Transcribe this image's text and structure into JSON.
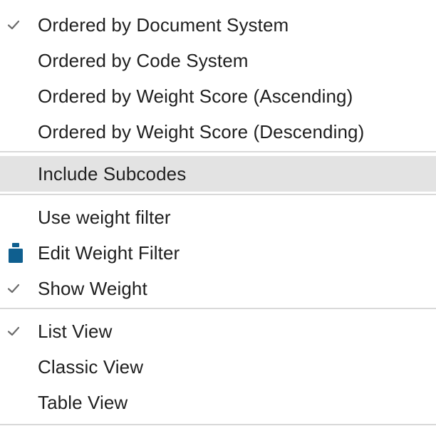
{
  "menu": {
    "sort_group": [
      {
        "label": "Ordered by Document System",
        "checked": true
      },
      {
        "label": "Ordered by Code System",
        "checked": false
      },
      {
        "label": "Ordered by Weight Score (Ascending)",
        "checked": false
      },
      {
        "label": "Ordered by Weight Score (Descending)",
        "checked": false
      }
    ],
    "subcodes_group": [
      {
        "label": "Include Subcodes",
        "checked": false,
        "highlighted": true
      }
    ],
    "weight_group": [
      {
        "label": "Use weight filter",
        "checked": false
      },
      {
        "label": "Edit Weight Filter",
        "icon": "weight-icon"
      },
      {
        "label": "Show Weight",
        "checked": true
      }
    ],
    "view_group": [
      {
        "label": "List View",
        "checked": true
      },
      {
        "label": "Classic View",
        "checked": false
      },
      {
        "label": "Table View",
        "checked": false
      }
    ]
  },
  "colors": {
    "highlight": "#e3e3e3",
    "separator": "#d9d9d9",
    "text": "#1f1f1f",
    "check": "#6b6b6b",
    "weight_icon": "#0f5f8f"
  }
}
